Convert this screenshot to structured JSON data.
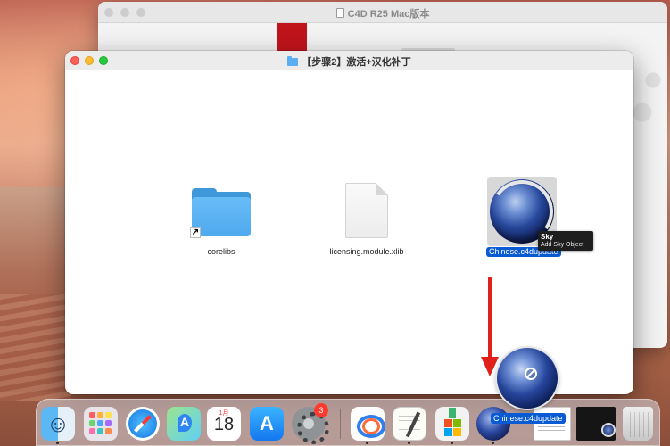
{
  "back_window": {
    "title": "C4D R25 Mac版本"
  },
  "front_window": {
    "title": "【步骤2】激活+汉化补丁",
    "items": [
      {
        "label": "corelibs",
        "icon": "folder-alias-icon"
      },
      {
        "label": "licensing.module.xlib",
        "icon": "document-icon"
      },
      {
        "label": "Chinese.c4dupdate",
        "icon": "cinema4d-icon",
        "selected": true
      }
    ]
  },
  "tooltip": {
    "title": "Sky",
    "subtitle": "Add Sky Object"
  },
  "drag": {
    "label": "Chinese.c4dupdate"
  },
  "dock": {
    "items": [
      "Finder",
      "Launchpad",
      "Safari",
      "Maps",
      "Calendar",
      "App Store",
      "System Preferences",
      "Baidu Netdisk",
      "TextEdit",
      "Installer",
      "Cinema 4D",
      "Document",
      "Screenshot",
      "Trash"
    ],
    "calendar_month": "1月",
    "calendar_day": "18",
    "settings_badge": "3"
  },
  "colors": {
    "selection": "#0a5bd3",
    "arrow": "#e0211b"
  }
}
